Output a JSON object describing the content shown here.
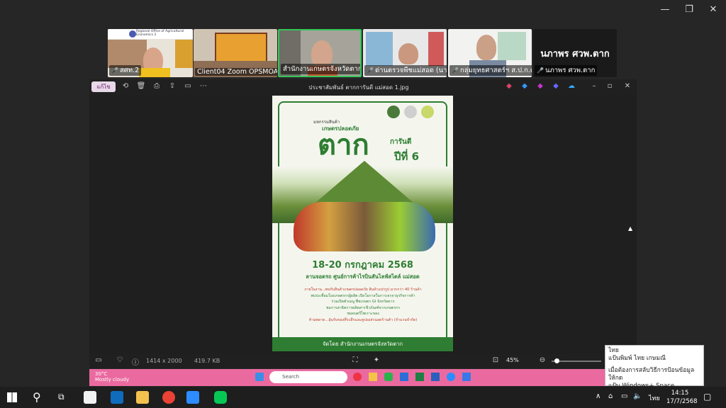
{
  "zoom": {
    "window_controls": {
      "minimize": "—",
      "restore": "❐",
      "close": "✕"
    },
    "participants": [
      {
        "label": "สศท.2",
        "org": "Regional Office of Agricultural Economics 2"
      },
      {
        "label": "Client04 Zoom OPSMOAC"
      },
      {
        "label": "สำนักงานเกษตรจังหวัดตาก"
      },
      {
        "label": "ด่านตรวจพืชแม่สอด (นาง..."
      },
      {
        "label": "กลุ่มยุทธศาสตร์ฯ ส.ป.ก.ต..."
      },
      {
        "label": "นภาพร ศวพ.ตาก",
        "display_name": "นภาพร ศวพ.ตาก"
      }
    ]
  },
  "photos": {
    "title": "ประชาสัมพันธ์ ตากการันตี แม่สอด 1.jpg",
    "edit_label": "แก้ไข",
    "dimensions": "1414 x 2000",
    "filesize": "419.7 KB",
    "zoom": "45%",
    "poster": {
      "kicker": "มหกรรมสินค้า",
      "headline_small": "เกษตรปลอดภัย",
      "brand": "ตาก",
      "brand_suffix": "การันตี",
      "edition": "ปีที่ 6",
      "date": "18-20 กรกฎาคม 2568",
      "venue": "ลานจอดรถ ศูนย์การค้าไรบินสันไลฟ์สไตล์ แม่สอด",
      "bullets": [
        "ภายในงาน...พบกับสินค้าเกษตรปลอดภัย สินค้าแปรรูป มากกว่า 40 ร้านค้า",
        "พบปะเชื่อมโยงเกษตรกรผู้ผลิต เปิดโอกาสในการเจรจาธุรกิจการค้า",
        "ร่วมเปิดตัวเมนู พืชเกษตร GI จังหวัดตาก",
        "ชมการสาธิตการผลิตสารชีวภัณฑ์จากเกษตรกร",
        "ชมดนตรีไพเราะของ",
        "ห้ามพลาด...ลุ้นรับของที่ระลึกและคูปองส่วนลดร้านค้า (จำนวนจำกัด)"
      ],
      "footer": "จัดโดย สำนักงานเกษตรจังหวัดตาก",
      "green": "#2e7d32"
    }
  },
  "inner_taskbar": {
    "weather_temp": "30°C",
    "weather_text": "Mostly cloudy",
    "search_placeholder": "Search"
  },
  "taskbar": {
    "time": "14:15",
    "date": "17/7/2568",
    "lang": "ไทย",
    "popup": {
      "line1": "ไทย",
      "line2": "แป้นพิมพ์ ไทย เกษมณี",
      "line3": "เมื่อต้องการสลับวิธีการป้อนข้อมูล ให้กด",
      "line4": "แป้น Windows+ Space"
    }
  }
}
